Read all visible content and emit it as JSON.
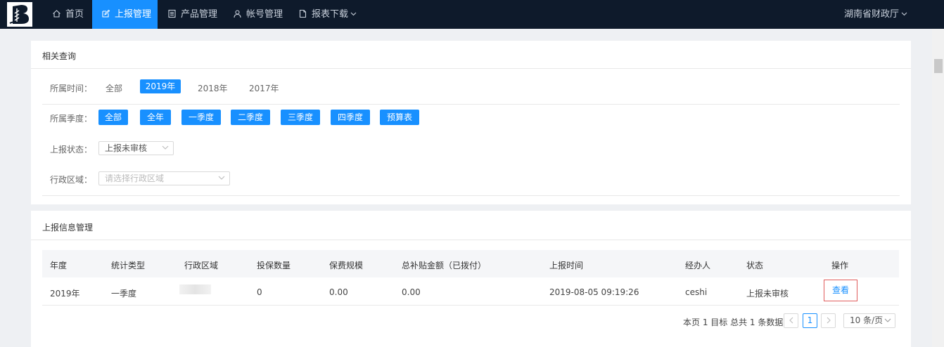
{
  "nav": {
    "items": [
      {
        "label": "首页",
        "icon": "home-icon"
      },
      {
        "label": "上报管理",
        "icon": "edit-icon",
        "active": true
      },
      {
        "label": "产品管理",
        "icon": "document-list-icon"
      },
      {
        "label": "帐号管理",
        "icon": "user-icon"
      },
      {
        "label": "报表下载",
        "icon": "file-icon",
        "dropdown": true
      }
    ],
    "user": "湖南省财政厅"
  },
  "query": {
    "title": "相关查询",
    "time_label": "所属时间：",
    "time_options": [
      "全部",
      "2019年",
      "2018年",
      "2017年"
    ],
    "time_selected": "2019年",
    "quarter_label": "所属季度：",
    "quarter_options": [
      "全部",
      "全年",
      "一季度",
      "二季度",
      "三季度",
      "四季度",
      "预算表"
    ],
    "status_label": "上报状态：",
    "status_value": "上报未审核",
    "region_label": "行政区域：",
    "region_placeholder": "请选择行政区域"
  },
  "table": {
    "title": "上报信息管理",
    "columns": [
      "年度",
      "统计类型",
      "行政区域",
      "投保数量",
      "保费规模",
      "总补贴金额（已拨付）",
      "上报时间",
      "经办人",
      "状态",
      "操作"
    ],
    "rows": [
      {
        "year": "2019年",
        "type": "一季度",
        "region": "",
        "count": "0",
        "premium": "0.00",
        "subsidy": "0.00",
        "time": "2019-08-05 09:19:26",
        "handler": "ceshi",
        "status": "上报未审核",
        "action": "查看"
      }
    ]
  },
  "pagination": {
    "info": "本页 1 目标 总共 1 条数据",
    "current_page": "1",
    "page_size": "10 条/页"
  },
  "colors": {
    "nav_bg": "#0e1a2b",
    "accent": "#1890ff",
    "highlight_border": "#e05b5b"
  }
}
